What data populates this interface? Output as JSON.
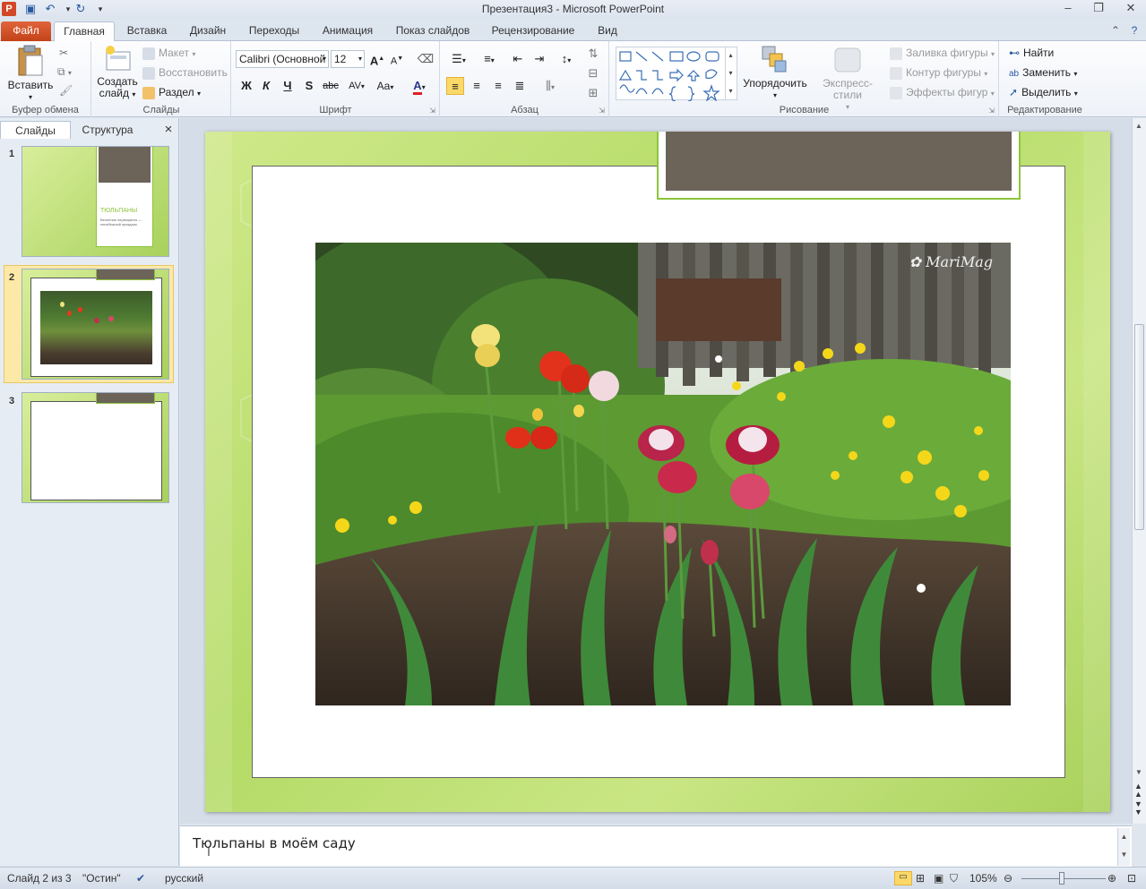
{
  "window": {
    "title": "Презентация3  -  Microsoft PowerPoint",
    "app_icon": "P"
  },
  "tabs": [
    "Файл",
    "Главная",
    "Вставка",
    "Дизайн",
    "Переходы",
    "Анимация",
    "Показ слайдов",
    "Рецензирование",
    "Вид"
  ],
  "ribbon": {
    "clipboard": {
      "paste": "Вставить",
      "label": "Буфер обмена"
    },
    "slides": {
      "new_slide_line1": "Создать",
      "new_slide_line2": "слайд",
      "layout": "Макет",
      "reset": "Восстановить",
      "section": "Раздел",
      "label": "Слайды"
    },
    "font": {
      "family": "Calibri (Основной",
      "size": "12",
      "bold": "Ж",
      "italic": "К",
      "underline": "Ч",
      "shadow": "S",
      "strike": "abc",
      "spacing": "AV",
      "case": "Aa",
      "color": "A",
      "grow": "A",
      "shrink": "A",
      "label": "Шрифт"
    },
    "paragraph": {
      "label": "Абзац"
    },
    "drawing": {
      "arrange": "Упорядочить",
      "quick_styles": "Экспресс-стили",
      "fill": "Заливка фигуры",
      "outline": "Контур фигуры",
      "effects": "Эффекты фигур",
      "label": "Рисование"
    },
    "editing": {
      "find": "Найти",
      "replace": "Заменить",
      "select": "Выделить",
      "label": "Редактирование"
    }
  },
  "panel": {
    "tab_slides": "Слайды",
    "tab_outline": "Структура",
    "close": "×",
    "thumbs": [
      {
        "num": "1",
        "title": "ТЮЛЬПАНЫ",
        "subtitle": "Весенние первоцветы — неизбежный праздник"
      },
      {
        "num": "2"
      },
      {
        "num": "3"
      }
    ]
  },
  "slide": {
    "watermark": "MariMag"
  },
  "notes": {
    "text": "Тюльпаны в моём саду"
  },
  "status": {
    "slide": "Слайд 2 из 3",
    "theme": "\"Остин\"",
    "language": "русский",
    "zoom": "105%"
  },
  "colors": {
    "accent_file_tab": "#c44319",
    "slide_green": "#b5db67",
    "title_box": "#6c6359",
    "title_border": "#8cc43c"
  }
}
